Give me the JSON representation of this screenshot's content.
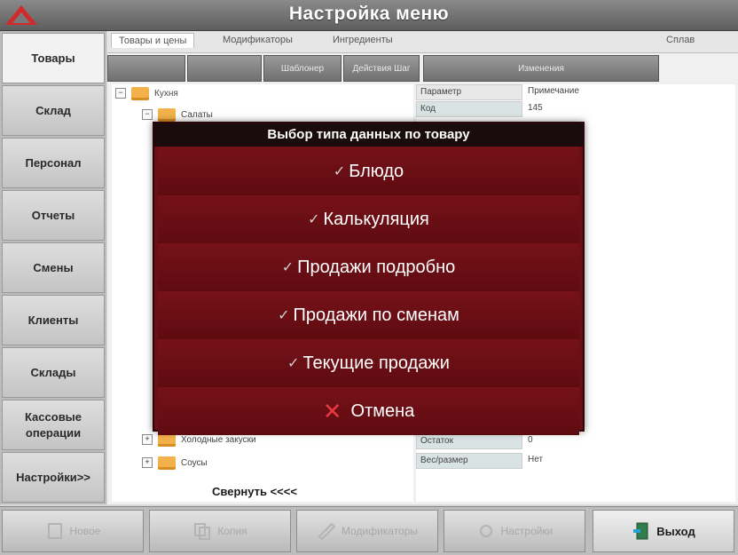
{
  "window": {
    "title": "Настройка меню"
  },
  "sidebar": {
    "items": [
      {
        "label": "Товары"
      },
      {
        "label": "Склад"
      },
      {
        "label": "Персонал"
      },
      {
        "label": "Отчеты"
      },
      {
        "label": "Смены"
      },
      {
        "label": "Клиенты"
      },
      {
        "label": "Склады"
      },
      {
        "label": "Кассовые операции"
      },
      {
        "label": "Настройки>>"
      }
    ]
  },
  "tabs": [
    {
      "label": "Товары и цены"
    },
    {
      "label": "Модификаторы"
    },
    {
      "label": "Ингредиенты"
    },
    {
      "label": "Сплав"
    }
  ],
  "toolbar": [
    {
      "label": ""
    },
    {
      "label": ""
    },
    {
      "label": "Шаблонер"
    },
    {
      "label": "Действия Шаг"
    },
    {
      "label": "Изменения"
    }
  ],
  "tree": {
    "rows": [
      {
        "expander": "−",
        "label": "Кухня"
      },
      {
        "expander": "−",
        "label": "Салаты"
      },
      {
        "expander": "+",
        "label": "Холодные закуски"
      },
      {
        "expander": "+",
        "label": "Соусы"
      }
    ]
  },
  "properties": {
    "header": {
      "name": "Параметр",
      "value": "Примечание"
    },
    "rows": [
      {
        "name": "Код",
        "value": "145"
      },
      {
        "name": "Остаток",
        "value": "0"
      },
      {
        "name": "Вес/размер",
        "value": "Нет"
      }
    ]
  },
  "collapse_label": "Свернуть <<<<",
  "footer": {
    "buttons": [
      {
        "label": "Новое"
      },
      {
        "label": "Копия"
      },
      {
        "label": "Модификаторы"
      },
      {
        "label": "Настройки"
      },
      {
        "label": "Выход"
      }
    ]
  },
  "dialog": {
    "title": "Выбор типа данных по товару",
    "options": [
      {
        "label": "Блюдо",
        "icon": "check-icon"
      },
      {
        "label": "Калькуляция",
        "icon": "check-icon"
      },
      {
        "label": "Продажи подробно",
        "icon": "check-icon"
      },
      {
        "label": "Продажи по сменам",
        "icon": "check-icon"
      },
      {
        "label": "Текущие продажи",
        "icon": "check-icon"
      },
      {
        "label": "Отмена",
        "icon": "cross-icon"
      }
    ]
  },
  "colors": {
    "dialog_bg": "#6a0f15",
    "dialog_header": "#1a0b0c",
    "cancel_accent": "#e8373f",
    "logo": "#d12a2a"
  }
}
